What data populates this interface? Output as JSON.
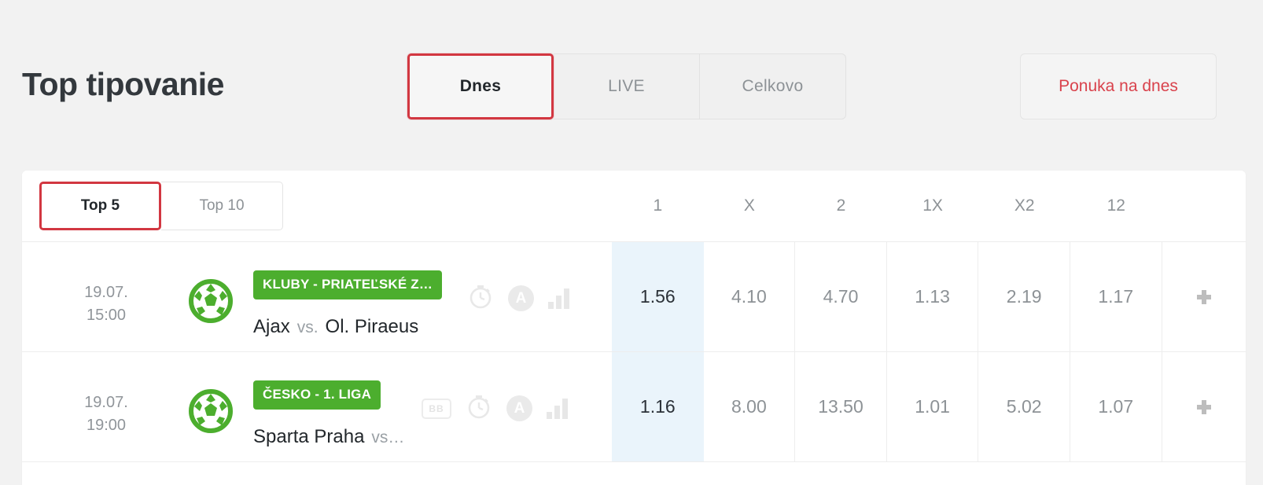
{
  "header": {
    "title": "Top tipovanie",
    "period_tabs": [
      {
        "label": "Dnes",
        "active": true
      },
      {
        "label": "LIVE",
        "active": false
      },
      {
        "label": "Celkovo",
        "active": false
      }
    ],
    "offer_button": "Ponuka na dnes"
  },
  "colors": {
    "accent_red": "#d23741",
    "league_green": "#4cae2e",
    "highlight_blue": "#eaf4fb",
    "page_background": "#f2f2f2"
  },
  "table": {
    "list_tabs": [
      {
        "label": "Top 5",
        "active": true
      },
      {
        "label": "Top 10",
        "active": false
      }
    ],
    "odds_columns": [
      "1",
      "X",
      "2",
      "1X",
      "X2",
      "12"
    ],
    "rows": [
      {
        "date": "19.07.",
        "time": "15:00",
        "sport_icon": "soccer-ball-icon",
        "league": "KLUBY - PRIATEĽSKÉ Z…",
        "home_team": "Ajax",
        "vs": "vs.",
        "away_team": "Ol. Piraeus",
        "icons": [
          "stopwatch-icon",
          "audio-commentary-icon",
          "statistics-icon"
        ],
        "bb_label": "",
        "odds": [
          "1.56",
          "4.10",
          "4.70",
          "1.13",
          "2.19",
          "1.17"
        ],
        "more_label": "+"
      },
      {
        "date": "19.07.",
        "time": "19:00",
        "sport_icon": "soccer-ball-icon",
        "league": "ČESKO - 1. LIGA",
        "home_team": "Sparta Praha",
        "vs": "vs…",
        "away_team": "",
        "icons": [
          "bb-icon",
          "stopwatch-icon",
          "audio-commentary-icon",
          "statistics-icon"
        ],
        "bb_label": "BB",
        "odds": [
          "1.16",
          "8.00",
          "13.50",
          "1.01",
          "5.02",
          "1.07"
        ],
        "more_label": "+"
      }
    ]
  }
}
